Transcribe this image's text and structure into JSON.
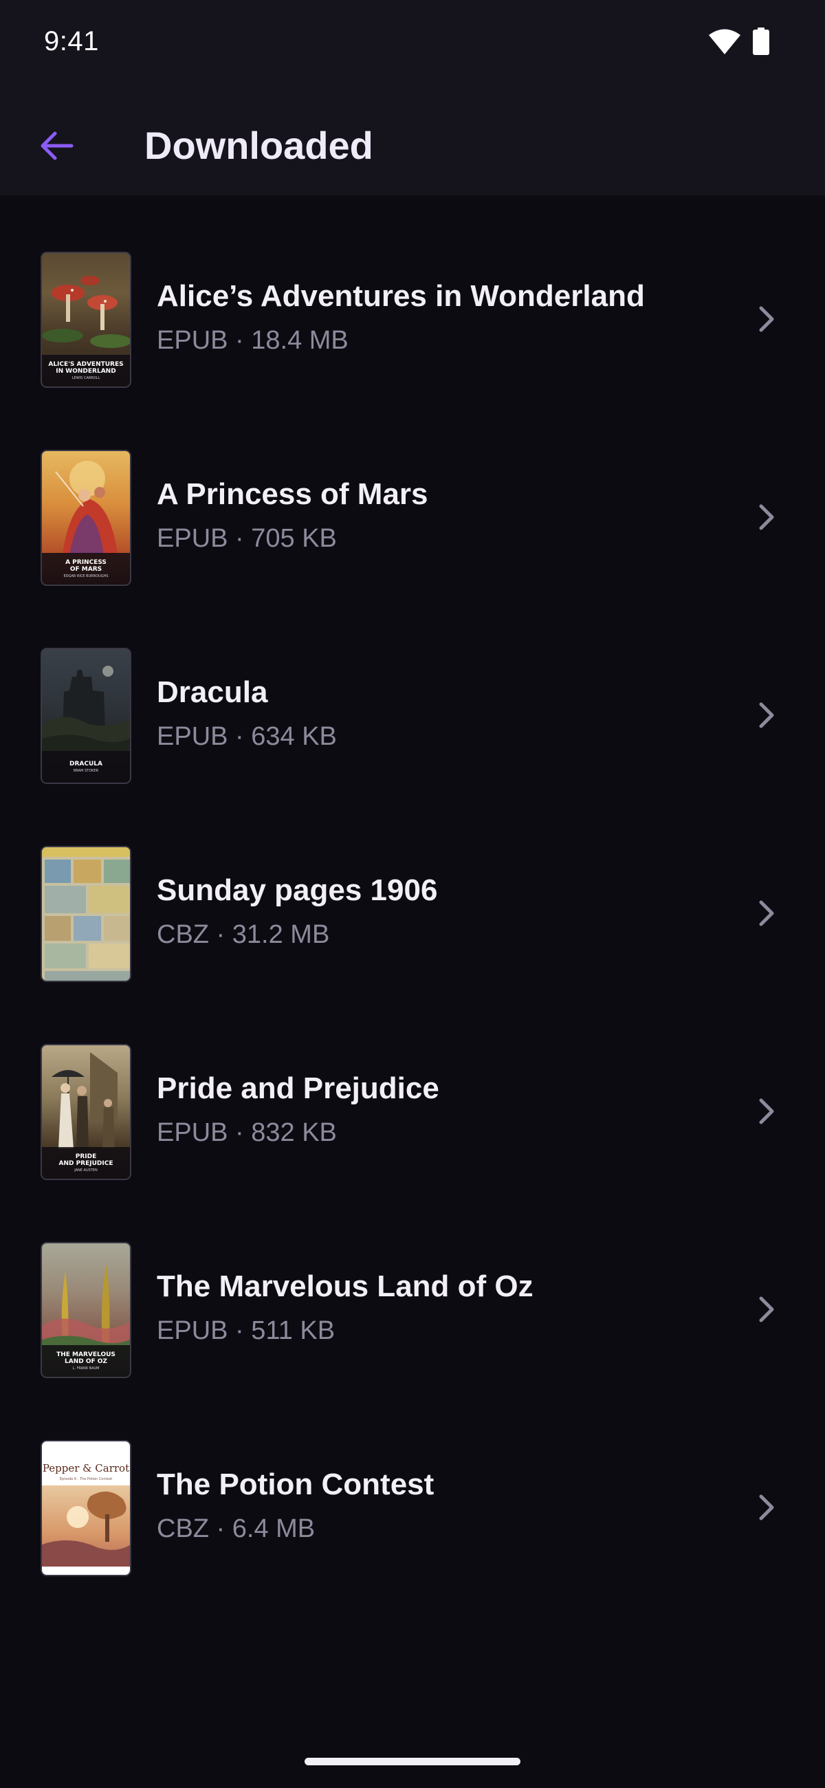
{
  "status_bar": {
    "time": "9:41",
    "icons": [
      "wifi-icon",
      "battery-icon"
    ]
  },
  "app_bar": {
    "title": "Downloaded",
    "back_icon": "arrow-left-icon",
    "accent_color": "#8b5cf6"
  },
  "books": [
    {
      "title": "Alice’s Adventures in Wonderland",
      "meta": "EPUB · 18.4 MB",
      "cover_title": "ALICE'S ADVENTURES\nIN WONDERLAND",
      "cover_author": "LEWIS CARROLL"
    },
    {
      "title": "A Princess of Mars",
      "meta": "EPUB · 705 KB",
      "cover_title": "A PRINCESS\nOF MARS",
      "cover_author": "EDGAR RICE BURROUGHS"
    },
    {
      "title": "Dracula",
      "meta": "EPUB · 634 KB",
      "cover_title": "DRACULA",
      "cover_author": "BRAM STOKER"
    },
    {
      "title": "Sunday pages 1906",
      "meta": "CBZ · 31.2 MB"
    },
    {
      "title": "Pride and Prejudice",
      "meta": "EPUB · 832 KB",
      "cover_title": "PRIDE\nAND PREJUDICE",
      "cover_author": "JANE AUSTEN"
    },
    {
      "title": "The Marvelous Land of Oz",
      "meta": "EPUB · 511 KB",
      "cover_title": "THE MARVELOUS\nLAND OF OZ",
      "cover_author": "L. FRANK BAUM"
    },
    {
      "title": "The Potion Contest",
      "meta": "CBZ · 6.4 MB",
      "cover_title": "Pepper & Carrot",
      "cover_author": "Episode 6 : The Potion Contest"
    }
  ],
  "row_chevron_icon": "chevron-right-icon",
  "colors": {
    "background": "#0c0b12",
    "app_bar": "#15141c",
    "title_text": "#f2eff7",
    "meta_text": "#8e8a9c"
  }
}
